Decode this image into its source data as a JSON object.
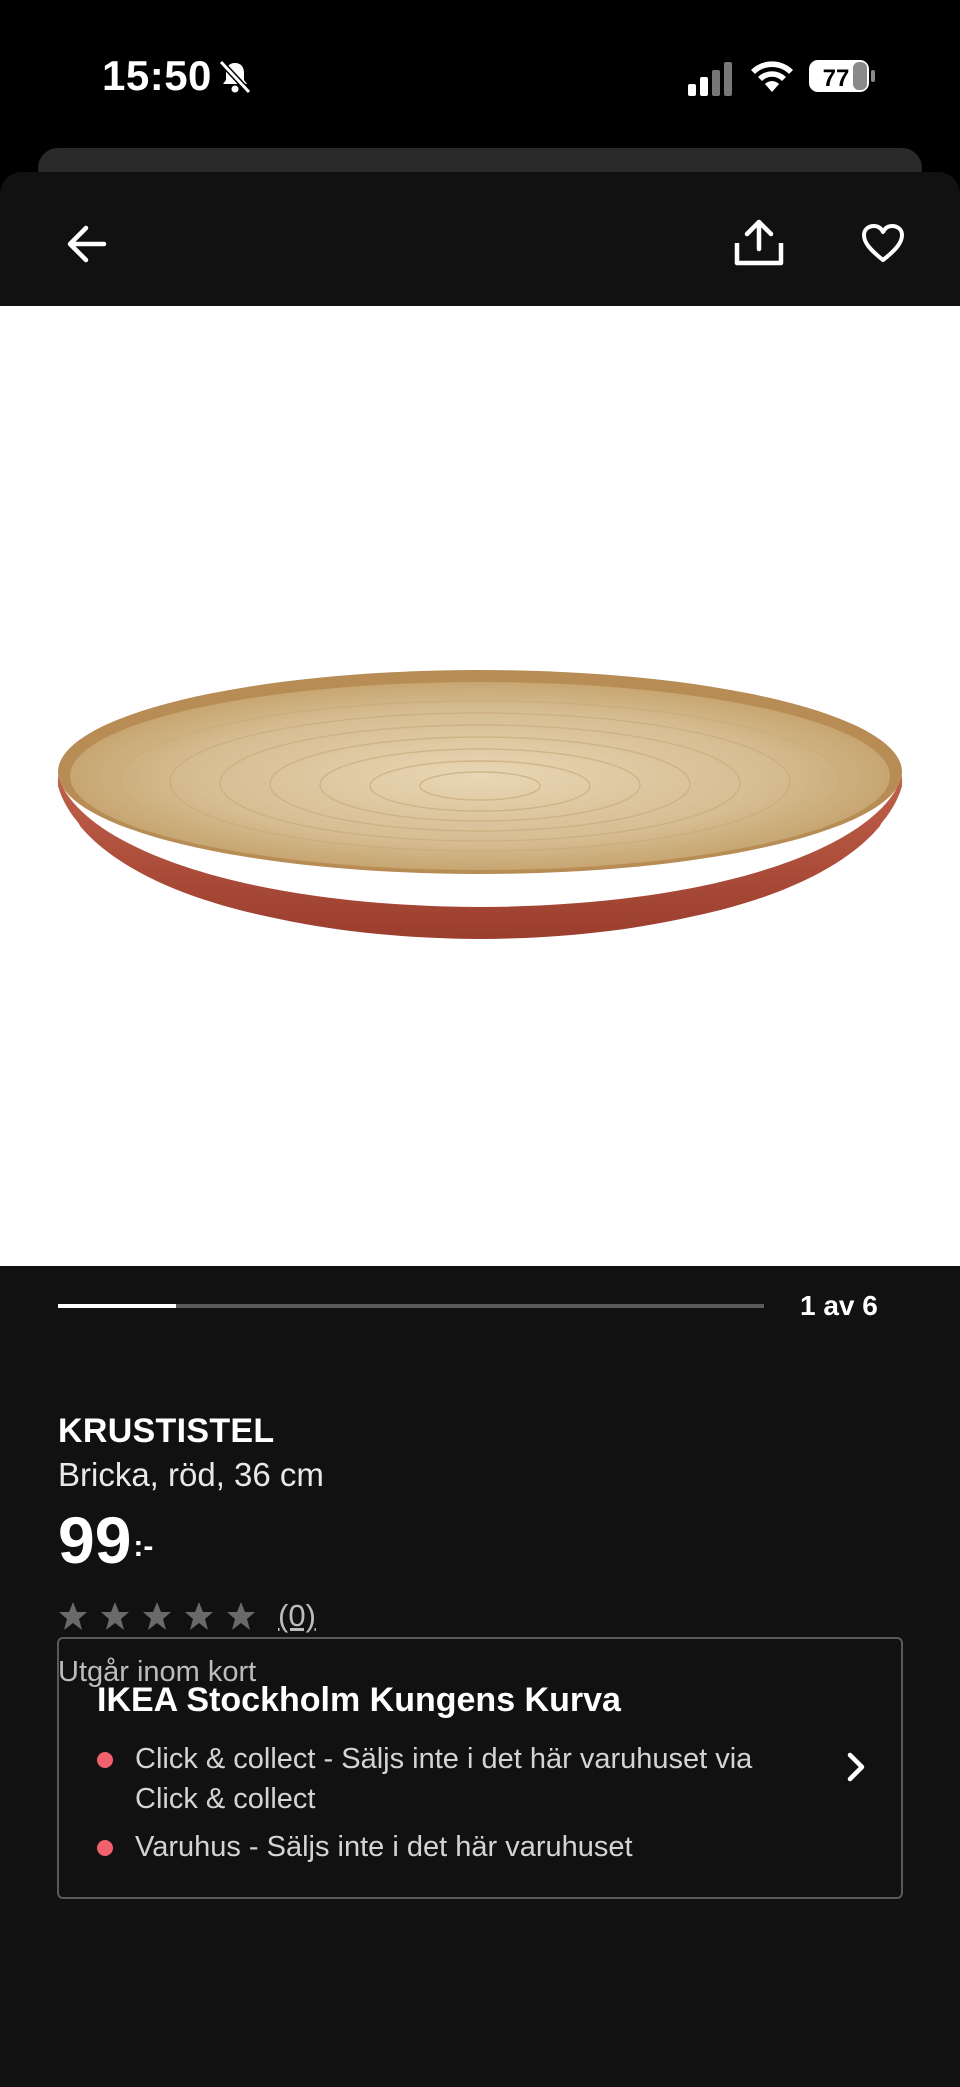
{
  "status_bar": {
    "time": "15:50",
    "battery_level": "77",
    "icons": [
      "bell-slash-icon",
      "signal-icon",
      "wifi-icon",
      "battery-icon"
    ]
  },
  "topbar": {
    "icons": [
      "arrow-left-icon",
      "share-icon",
      "heart-icon"
    ]
  },
  "carousel": {
    "current": 1,
    "total": 6,
    "label": "1 av 6",
    "progress_fraction": 0.1667
  },
  "product": {
    "name": "KRUSTISTEL",
    "description": "Bricka, röd, 36 cm",
    "price_integer": "99",
    "price_suffix": ":-",
    "rating_stars": 0,
    "rating_max": 5,
    "rating_count": "(0)",
    "availability_note": "Utgår inom kort"
  },
  "store": {
    "name": "IKEA Stockholm Kungens Kurva",
    "lines": [
      "Click & collect - Säljs inte i det här varuhuset via Click & collect",
      "Varuhus - Säljs inte i det här varuhuset"
    ],
    "status_color": "#f0606d"
  },
  "colors": {
    "background": "#111111",
    "image_background": "#ffffff",
    "tray_rim": "#b5533f",
    "tray_wood": "#d9c29a"
  }
}
